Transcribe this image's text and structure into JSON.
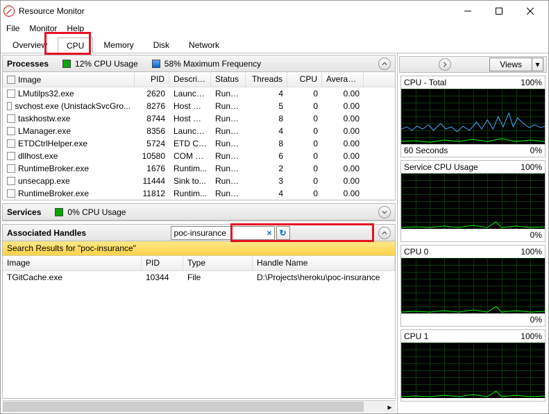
{
  "window": {
    "title": "Resource Monitor"
  },
  "menu": [
    "File",
    "Monitor",
    "Help"
  ],
  "tabs": [
    "Overview",
    "CPU",
    "Memory",
    "Disk",
    "Network"
  ],
  "active_tab": "CPU",
  "processes": {
    "title": "Processes",
    "stat1": "12% CPU Usage",
    "stat2": "58% Maximum Frequency",
    "columns": [
      "Image",
      "PID",
      "Descrip...",
      "Status",
      "Threads",
      "CPU",
      "Averag..."
    ],
    "rows": [
      {
        "img": "LMutilps32.exe",
        "pid": "2620",
        "desc": "Launch...",
        "stat": "Runni...",
        "thr": "4",
        "cpu": "0",
        "avg": "0.00"
      },
      {
        "img": "svchost.exe (UnistackSvcGro...",
        "pid": "8276",
        "desc": "Host Pr...",
        "stat": "Runni...",
        "thr": "5",
        "cpu": "0",
        "avg": "0.00"
      },
      {
        "img": "taskhostw.exe",
        "pid": "8744",
        "desc": "Host Pr...",
        "stat": "Runni...",
        "thr": "8",
        "cpu": "0",
        "avg": "0.00"
      },
      {
        "img": "LManager.exe",
        "pid": "8356",
        "desc": "Launch...",
        "stat": "Runni...",
        "thr": "4",
        "cpu": "0",
        "avg": "0.00"
      },
      {
        "img": "ETDCtrlHelper.exe",
        "pid": "5724",
        "desc": "ETD Co...",
        "stat": "Runni...",
        "thr": "8",
        "cpu": "0",
        "avg": "0.00"
      },
      {
        "img": "dllhost.exe",
        "pid": "10580",
        "desc": "COM S...",
        "stat": "Runni...",
        "thr": "6",
        "cpu": "0",
        "avg": "0.00"
      },
      {
        "img": "RuntimeBroker.exe",
        "pid": "1676",
        "desc": "Runtim...",
        "stat": "Runni...",
        "thr": "2",
        "cpu": "0",
        "avg": "0.00"
      },
      {
        "img": "unsecapp.exe",
        "pid": "11444",
        "desc": "Sink to...",
        "stat": "Runni...",
        "thr": "3",
        "cpu": "0",
        "avg": "0.00"
      },
      {
        "img": "RuntimeBroker.exe",
        "pid": "11812",
        "desc": "Runtim...",
        "stat": "Runni...",
        "thr": "4",
        "cpu": "0",
        "avg": "0.00"
      }
    ]
  },
  "services": {
    "title": "Services",
    "stat1": "0% CPU Usage"
  },
  "handles": {
    "title": "Associated Handles",
    "search_value": "poc-insurance",
    "results_label": "Search Results for \"poc-insurance\"",
    "columns": [
      "Image",
      "PID",
      "Type",
      "Handle Name"
    ],
    "rows": [
      {
        "img": "TGitCache.exe",
        "pid": "10344",
        "type": "File",
        "name": "D:\\Projects\\heroku\\poc-insurance"
      }
    ]
  },
  "right": {
    "views_label": "Views",
    "graphs": [
      {
        "title": "CPU - Total",
        "tr": "100%",
        "bl": "60 Seconds",
        "br": "0%"
      },
      {
        "title": "Service CPU Usage",
        "tr": "100%",
        "bl": "",
        "br": "0%"
      },
      {
        "title": "CPU 0",
        "tr": "100%",
        "bl": "",
        "br": "0%"
      },
      {
        "title": "CPU 1",
        "tr": "100%",
        "bl": "",
        "br": ""
      }
    ]
  }
}
